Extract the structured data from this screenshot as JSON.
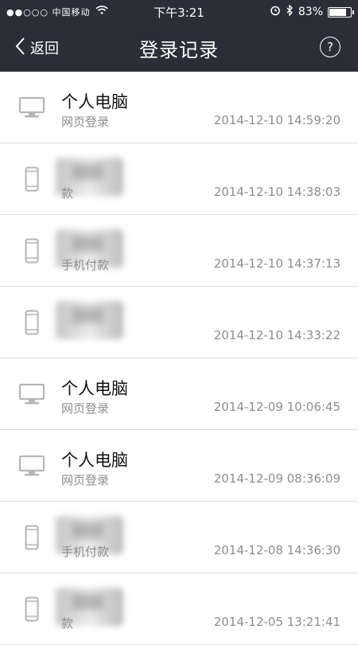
{
  "status_bar": {
    "carrier": "●●○○○ 中国移动",
    "time": "下午3:21",
    "battery": "83%",
    "battery_level": 0.83
  },
  "nav": {
    "back_label": "返回",
    "title": "登录记录",
    "help_label": "?"
  },
  "records": [
    {
      "device": "pc",
      "title": "个人电脑",
      "subtitle": "网页登录",
      "time": "2014-12-10 14:59:20",
      "blurred": false
    },
    {
      "device": "phone",
      "title": "",
      "subtitle": "款",
      "time": "2014-12-10 14:38:03",
      "blurred": true
    },
    {
      "device": "phone",
      "title": "",
      "subtitle": "手机付款",
      "time": "2014-12-10 14:37:13",
      "blurred": true
    },
    {
      "device": "phone",
      "title": "",
      "subtitle": "",
      "time": "2014-12-10 14:33:22",
      "blurred": true
    },
    {
      "device": "pc",
      "title": "个人电脑",
      "subtitle": "网页登录",
      "time": "2014-12-09 10:06:45",
      "blurred": false
    },
    {
      "device": "pc",
      "title": "个人电脑",
      "subtitle": "网页登录",
      "time": "2014-12-09 08:36:09",
      "blurred": false
    },
    {
      "device": "phone",
      "title": "",
      "subtitle": "手机付款",
      "time": "2014-12-08 14:36:30",
      "blurred": true
    },
    {
      "device": "phone",
      "title": "",
      "subtitle": "款",
      "time": "2014-12-05 13:21:41",
      "blurred": true
    }
  ]
}
